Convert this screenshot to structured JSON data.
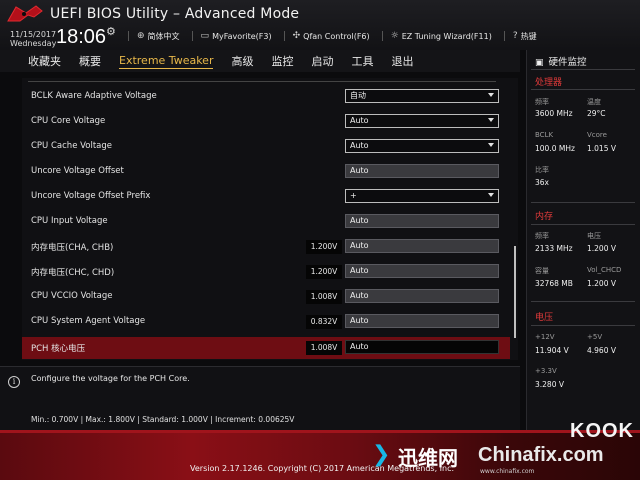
{
  "header": {
    "title": "UEFI BIOS Utility – Advanced Mode",
    "date": "11/15/2017",
    "day": "Wednesday",
    "time": "18:06",
    "toolbar": [
      {
        "icon": "globe-icon",
        "glyph": "⊕",
        "label": "简体中文"
      },
      {
        "icon": "favorite-icon",
        "glyph": "▭",
        "label": "MyFavorite(F3)"
      },
      {
        "icon": "fan-icon",
        "glyph": "✣",
        "label": "Qfan Control(F6)"
      },
      {
        "icon": "bulb-icon",
        "glyph": "☼",
        "label": "EZ Tuning Wizard(F11)"
      },
      {
        "icon": "question-icon",
        "glyph": "?",
        "label": "热键"
      }
    ]
  },
  "tabs": [
    "收藏夹",
    "概要",
    "Extreme Tweaker",
    "高级",
    "监控",
    "启动",
    "工具",
    "退出"
  ],
  "active_tab": "Extreme Tweaker",
  "settings": [
    {
      "label": "BCLK Aware Adaptive Voltage",
      "value": "",
      "field": "自动",
      "type": "select"
    },
    {
      "label": "CPU Core Voltage",
      "value": "",
      "field": "Auto",
      "type": "select"
    },
    {
      "label": "CPU Cache Voltage",
      "value": "",
      "field": "Auto",
      "type": "select"
    },
    {
      "label": "Uncore Voltage Offset",
      "value": "",
      "field": "Auto",
      "type": "input"
    },
    {
      "label": "Uncore Voltage Offset Prefix",
      "value": "",
      "field": "+",
      "type": "select"
    },
    {
      "label": "CPU Input Voltage",
      "value": "",
      "field": "Auto",
      "type": "input"
    },
    {
      "label": "内存电压(CHA, CHB)",
      "value": "1.200V",
      "field": "Auto",
      "type": "input"
    },
    {
      "label": "内存电压(CHC, CHD)",
      "value": "1.200V",
      "field": "Auto",
      "type": "input"
    },
    {
      "label": "CPU VCCIO Voltage",
      "value": "1.008V",
      "field": "Auto",
      "type": "input"
    },
    {
      "label": "CPU System Agent Voltage",
      "value": "0.832V",
      "field": "Auto",
      "type": "input"
    },
    {
      "label": "PCH 核心电压",
      "value": "1.008V",
      "field": "Auto",
      "type": "input",
      "selected": true
    }
  ],
  "help": {
    "text": "Configure the voltage for the PCH Core.",
    "specs": "Min.: 0.700V   |   Max.: 1.800V   |   Standard: 1.000V   |   Increment: 0.00625V"
  },
  "monitor": {
    "title": "硬件监控",
    "cpu": {
      "section": "处理器",
      "freq_label": "频率",
      "freq": "3600 MHz",
      "temp_label": "温度",
      "temp": "29°C",
      "bclk_label": "BCLK",
      "bclk": "100.0 MHz",
      "vcore_label": "Vcore",
      "vcore": "1.015 V",
      "ratio_label": "比率",
      "ratio": "36x"
    },
    "memory": {
      "section": "内存",
      "freq_label": "频率",
      "freq": "2133 MHz",
      "volt_label": "电压",
      "volt": "1.200 V",
      "cap_label": "容量",
      "cap": "32768 MB",
      "volchcd_label": "Vol_CHCD",
      "volchcd": "1.200 V"
    },
    "voltage": {
      "section": "电压",
      "v12_label": "+12V",
      "v12": "11.904 V",
      "v5_label": "+5V",
      "v5": "4.960 V",
      "v33_label": "+3.3V",
      "v33": "3.280 V"
    }
  },
  "footer": {
    "version": "Version 2.17.1246. Copyright (C) 2017 American Megatrends, Inc.",
    "wm_cn": "迅维网",
    "wm_en": "Chinafix.com",
    "wm_sub": "www.chinafix.com",
    "kook": "KOOK"
  },
  "colors": {
    "accent": "#e8b84a",
    "selected_row": "#6e0d13",
    "monitor_section": "#e03a3a"
  }
}
